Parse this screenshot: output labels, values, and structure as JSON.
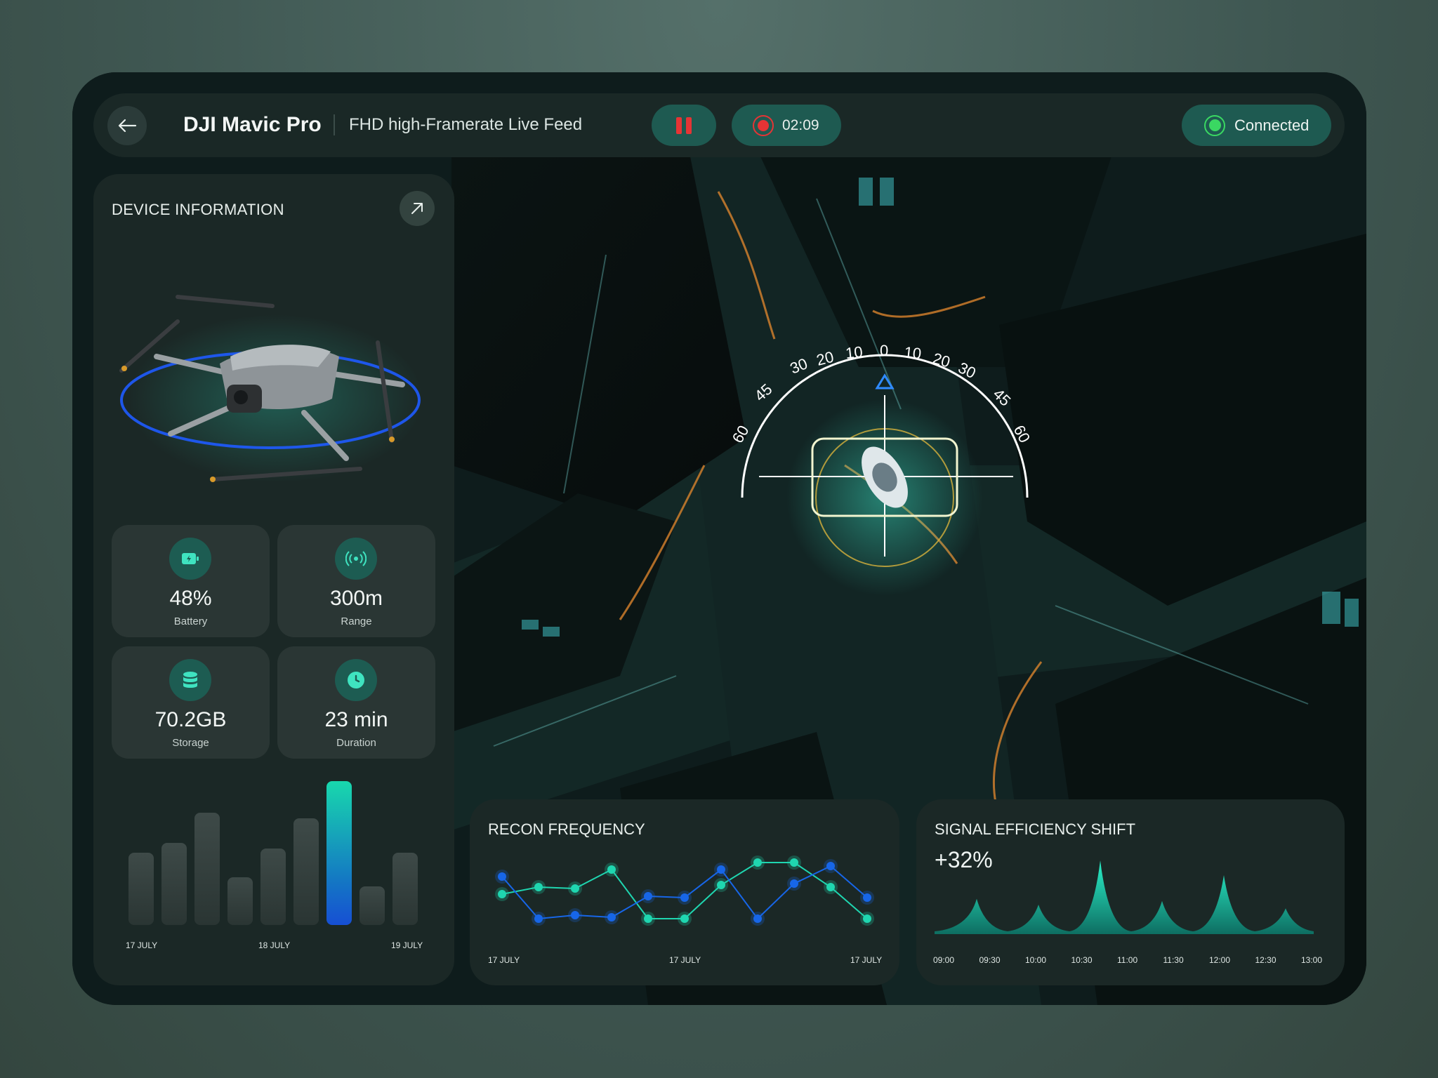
{
  "header": {
    "title": "DJI Mavic Pro",
    "subtitle": "FHD high-Framerate Live Feed",
    "recording_time": "02:09",
    "connection_status": "Connected",
    "colors": {
      "record": "#e53435",
      "connected": "#3ad862",
      "pill": "#1e5a51"
    }
  },
  "device_info": {
    "heading": "DEVICE INFORMATION",
    "stats": [
      {
        "value": "48%",
        "label": "Battery",
        "icon": "battery-icon"
      },
      {
        "value": "300m",
        "label": "Range",
        "icon": "signal-icon"
      },
      {
        "value": "70.2GB",
        "label": "Storage",
        "icon": "database-icon"
      },
      {
        "value": "23 min",
        "label": "Duration",
        "icon": "clock-icon"
      }
    ],
    "chart_data": {
      "type": "bar",
      "values": [
        0.5,
        0.57,
        0.78,
        0.33,
        0.53,
        0.74,
        1.0,
        0.27,
        0.5
      ],
      "highlight_index": 6,
      "tick_labels": [
        "17 JULY",
        "18 JULY",
        "19 JULY"
      ]
    }
  },
  "hud": {
    "ticks_left": [
      "60",
      "45",
      "30",
      "20",
      "10"
    ],
    "tick_center": "0",
    "ticks_right": [
      "10",
      "20",
      "30",
      "45",
      "60"
    ]
  },
  "recon_frequency": {
    "title": "RECON FREQUENCY",
    "chart_data": {
      "type": "line",
      "x_labels": [
        "17 JULY",
        "17 JULY",
        "17 JULY"
      ],
      "series": [
        {
          "color": "#1fd6b0",
          "values": [
            0.55,
            0.65,
            0.63,
            0.9,
            0.2,
            0.2,
            0.68,
            1.0,
            1.0,
            0.65,
            0.2
          ]
        },
        {
          "color": "#1766e8",
          "values": [
            0.8,
            0.2,
            0.25,
            0.22,
            0.52,
            0.5,
            0.9,
            0.2,
            0.7,
            0.95,
            0.5
          ]
        }
      ]
    }
  },
  "signal_efficiency": {
    "title": "SIGNAL EFFICIENCY SHIFT",
    "change": "+32%",
    "chart_data": {
      "type": "area",
      "x": [
        "09:00",
        "09:30",
        "10:00",
        "10:30",
        "11:00",
        "11:30",
        "12:00",
        "12:30",
        "13:00"
      ],
      "peaks": [
        0.48,
        0.4,
        1.0,
        0.45,
        0.8,
        0.35
      ]
    }
  }
}
